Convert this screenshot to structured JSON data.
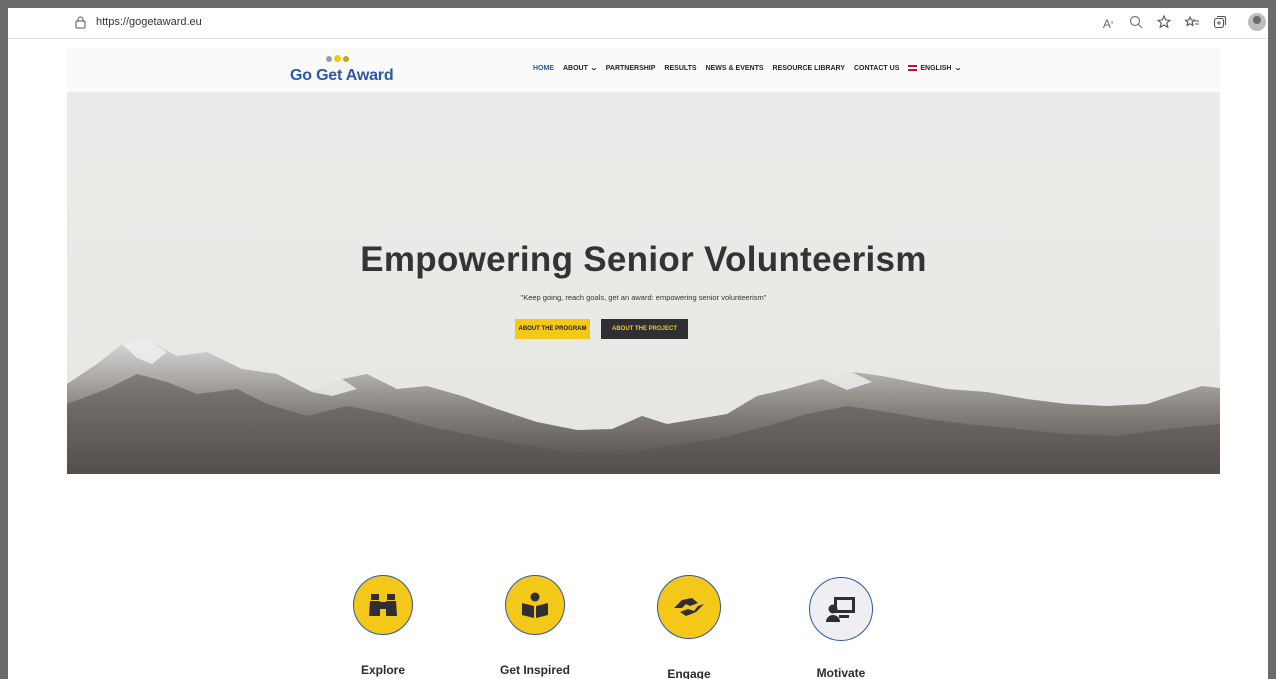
{
  "browser": {
    "url": "https://gogetaward.eu",
    "icons": [
      "read-aloud-icon",
      "zoom-icon",
      "favorite-add-icon",
      "favorites-icon",
      "collections-icon",
      "profile-icon"
    ]
  },
  "header": {
    "logo_text": "Go Get Award",
    "logo_dot_colors": [
      "#9aa0a6",
      "#f4c819",
      "#c8a318"
    ],
    "nav": [
      {
        "label": "HOME",
        "active": true
      },
      {
        "label": "ABOUT",
        "dropdown": true
      },
      {
        "label": "PARTNERSHIP"
      },
      {
        "label": "RESULTS"
      },
      {
        "label": "NEWS & EVENTS"
      },
      {
        "label": "RESOURCE LIBRARY"
      },
      {
        "label": "CONTACT US"
      },
      {
        "label": "ENGLISH",
        "dropdown": true,
        "icon": "uk-flag-icon"
      }
    ]
  },
  "hero": {
    "title": "Empowering Senior Volunteerism",
    "subtitle": "\"Keep going, reach goals, get an award: empowering senior volunteerism\"",
    "primary_button": "ABOUT THE PROGRAM",
    "secondary_button": "ABOUT THE PROJECT"
  },
  "features": [
    {
      "label": "Explore",
      "icon": "binoculars-icon"
    },
    {
      "label": "Get Inspired",
      "icon": "reader-icon"
    },
    {
      "label": "Engage",
      "icon": "handshake-icon"
    },
    {
      "label": "Motivate",
      "icon": "presentation-icon"
    }
  ],
  "colors": {
    "accent_yellow": "#f4c819",
    "brand_blue": "#2a57a8",
    "dark": "#2e2e33"
  }
}
